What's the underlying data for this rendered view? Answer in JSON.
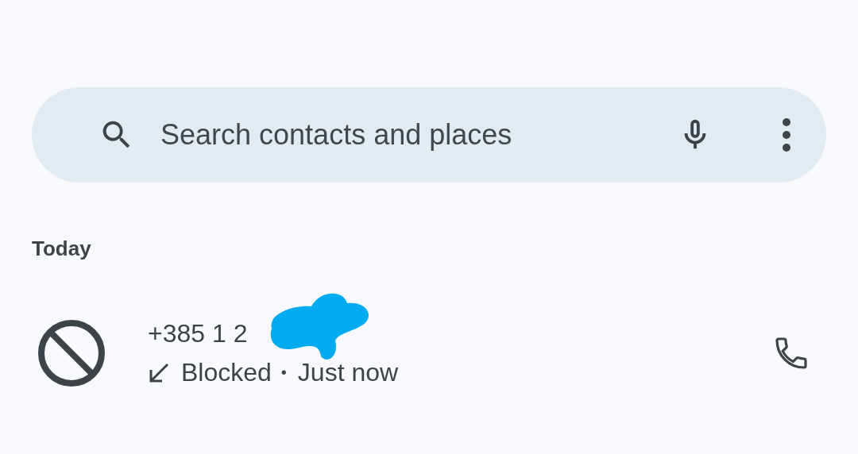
{
  "search": {
    "placeholder": "Search contacts and places"
  },
  "sections": [
    {
      "title": "Today",
      "calls": [
        {
          "number": "+385 1 2",
          "blocked": true,
          "incoming": true,
          "status": "Blocked",
          "separator": "•",
          "time": "Just now",
          "redacted": true
        }
      ]
    }
  ]
}
